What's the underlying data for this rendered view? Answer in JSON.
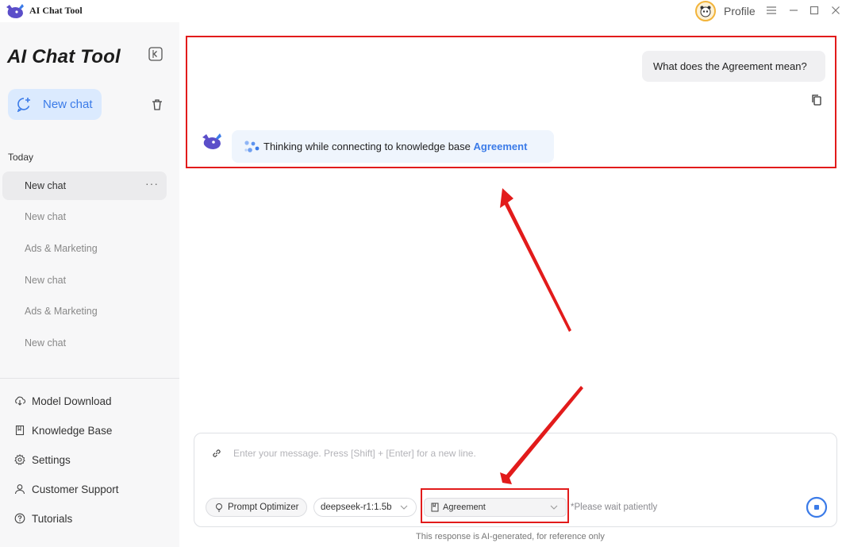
{
  "titlebar": {
    "app_name": "AI Chat Tool",
    "profile_label": "Profile",
    "logo_icon": "whale-logo-icon",
    "controls": [
      "menu-icon",
      "minimize-icon",
      "maximize-icon",
      "close-icon"
    ]
  },
  "sidebar": {
    "brand": "AI Chat Tool",
    "new_chat_label": "New chat",
    "section_label": "Today",
    "history": [
      {
        "label": "New chat",
        "active": true
      },
      {
        "label": "New chat",
        "active": false
      },
      {
        "label": "Ads & Marketing",
        "active": false
      },
      {
        "label": "New chat",
        "active": false
      },
      {
        "label": "Ads & Marketing",
        "active": false
      },
      {
        "label": "New chat",
        "active": false
      }
    ],
    "more_label": "···",
    "nav": [
      {
        "label": "Model Download",
        "icon": "cloud-download-icon"
      },
      {
        "label": "Knowledge Base",
        "icon": "book-icon"
      },
      {
        "label": "Settings",
        "icon": "gear-icon"
      },
      {
        "label": "Customer Support",
        "icon": "person-icon"
      },
      {
        "label": "Tutorials",
        "icon": "help-circle-icon"
      }
    ]
  },
  "chat": {
    "user_message": "What does the Agreement mean?",
    "thinking_prefix": "Thinking while connecting to knowledge base ",
    "thinking_kb": "Agreement"
  },
  "composer": {
    "placeholder": "Enter your message. Press [Shift] + [Enter] for a new line.",
    "prompt_optimizer_label": "Prompt Optimizer",
    "model_label": "deepseek-r1:1.5b",
    "kb_label": "Agreement",
    "wait_note": "*Please wait patiently",
    "disclaimer": "This response is AI-generated, for reference only"
  },
  "colors": {
    "accent": "#3b7be8",
    "annotation": "#e21b1b",
    "sidebar_bg": "#f7f7f8"
  }
}
